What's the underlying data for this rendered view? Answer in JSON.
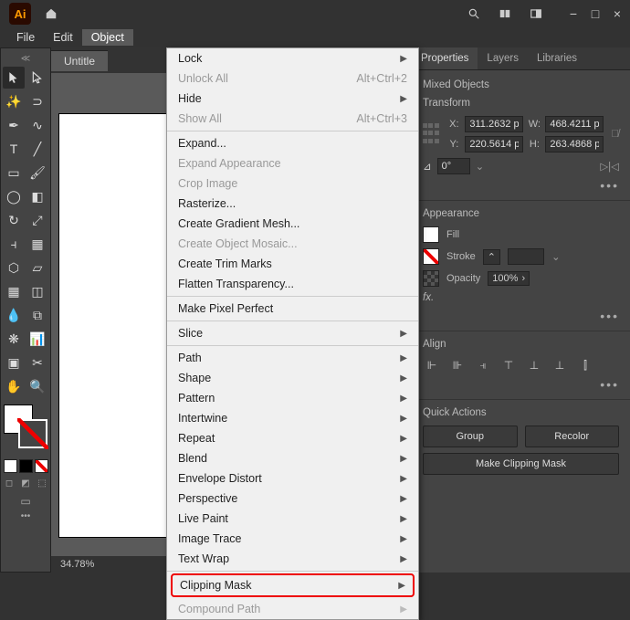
{
  "topbar": {
    "logo": "Ai"
  },
  "menubar": {
    "file": "File",
    "edit": "Edit",
    "object": "Object"
  },
  "doc": {
    "tab": "Untitle",
    "zoom": "34.78%"
  },
  "dropdown": {
    "lock": "Lock",
    "unlock_all": "Unlock All",
    "unlock_all_key": "Alt+Ctrl+2",
    "hide": "Hide",
    "show_all": "Show All",
    "show_all_key": "Alt+Ctrl+3",
    "expand": "Expand...",
    "expand_appearance": "Expand Appearance",
    "crop_image": "Crop Image",
    "rasterize": "Rasterize...",
    "create_gradient_mesh": "Create Gradient Mesh...",
    "create_object_mosaic": "Create Object Mosaic...",
    "create_trim_marks": "Create Trim Marks",
    "flatten_transparency": "Flatten Transparency...",
    "make_pixel_perfect": "Make Pixel Perfect",
    "slice": "Slice",
    "path": "Path",
    "shape": "Shape",
    "pattern": "Pattern",
    "intertwine": "Intertwine",
    "repeat": "Repeat",
    "blend": "Blend",
    "envelope_distort": "Envelope Distort",
    "perspective": "Perspective",
    "live_paint": "Live Paint",
    "image_trace": "Image Trace",
    "text_wrap": "Text Wrap",
    "clipping_mask": "Clipping Mask",
    "compound_path": "Compound Path"
  },
  "panels": {
    "tabs": {
      "properties": "Properties",
      "layers": "Layers",
      "libraries": "Libraries"
    },
    "selection": "Mixed Objects",
    "transform": {
      "title": "Transform",
      "x": "311.2632 p",
      "y": "220.5614 p",
      "w": "468.4211 p",
      "h": "263.4868 p",
      "angle": "0°"
    },
    "appearance": {
      "title": "Appearance",
      "fill": "Fill",
      "stroke": "Stroke",
      "opacity": "Opacity",
      "opacity_value": "100%",
      "fx": "fx."
    },
    "align": {
      "title": "Align"
    },
    "quick": {
      "title": "Quick Actions",
      "group": "Group",
      "recolor": "Recolor",
      "make_clipping_mask": "Make Clipping Mask"
    }
  }
}
